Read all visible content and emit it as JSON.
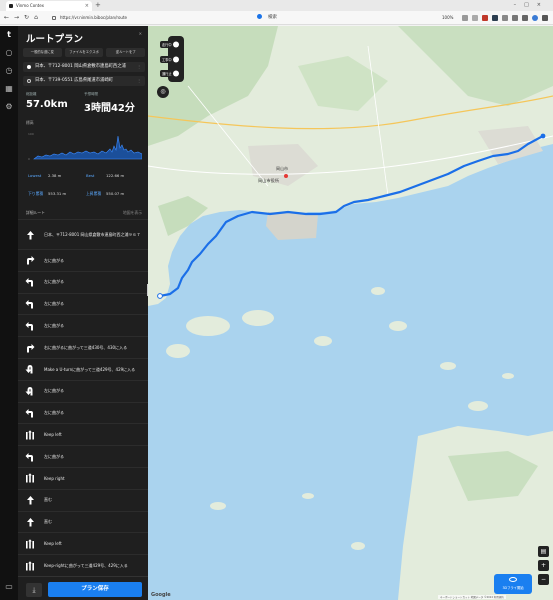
{
  "browser": {
    "tab_title": "Vinmo Contex",
    "url": "https://vr.ninmin.biboc/plan/route",
    "search_label": "検索",
    "zoom": "100%"
  },
  "panel": {
    "title": "ルートプラン",
    "actions": [
      "一般的な道に変",
      "ファイルをエクスポ",
      "逆ルートをプ"
    ],
    "waypoints": [
      "日本、〒712-8001 岡山県倉敷市連島町西之浦",
      "日本、〒739-0551 広島県尾道市浦崎町"
    ],
    "distance_label": "総距離",
    "distance": "57.0km",
    "duration_label": "予想時間",
    "duration": "3時間42分",
    "elevation_title": "標高",
    "elev_ymax": "100",
    "elev_yzero": "0",
    "stats": [
      {
        "k": "Lowest",
        "v": "2.38 m"
      },
      {
        "k": "Best",
        "v": "122.66 m"
      },
      {
        "k": "下り累積",
        "v": "553.31 m"
      },
      {
        "k": "上昇累積",
        "v": "550.07 m"
      }
    ],
    "details_title": "詳細ルート",
    "details_more": "地図を表示",
    "save_label": "プラン保存"
  },
  "steps": [
    {
      "icon": "up",
      "text": "日本、〒712-8001 岡山県倉敷市連島町西之浦９６７"
    },
    {
      "icon": "right",
      "text": "左に曲がる"
    },
    {
      "icon": "left",
      "text": "左に曲がる"
    },
    {
      "icon": "left",
      "text": "左に曲がる"
    },
    {
      "icon": "left",
      "text": "左に曲がる"
    },
    {
      "icon": "right",
      "text": "右に曲がるに曲がって三道430号、430に入る"
    },
    {
      "icon": "uturn",
      "text": "Make a U-turnに曲がって三道429号、429に入る"
    },
    {
      "icon": "uturn",
      "text": "左に曲がる"
    },
    {
      "icon": "left",
      "text": "左に曲がる"
    },
    {
      "icon": "keep",
      "text": "Keep left"
    },
    {
      "icon": "left",
      "text": "左に曲がる"
    },
    {
      "icon": "keep",
      "text": "Keep right"
    },
    {
      "icon": "up",
      "text": "直む"
    },
    {
      "icon": "up",
      "text": "直む"
    },
    {
      "icon": "keep",
      "text": "Keep left"
    },
    {
      "icon": "keep",
      "text": "Keep-rightに曲がって三道429号、429に入る"
    }
  ],
  "map": {
    "city_label": "岡山市",
    "city_mark": "岡山市役所",
    "layer_tags": [
      "走行中",
      "工事中",
      "通行止"
    ],
    "route_3d_label": "3Dフライ開始",
    "google": "Google",
    "attribution": "キーボードショートカット  地図データ ©2024  利用規約",
    "colors": {
      "route": "#1b6fe8",
      "sea": "#aad3ee",
      "land": "#e8efe3",
      "hill": "#c9dfc0"
    }
  }
}
